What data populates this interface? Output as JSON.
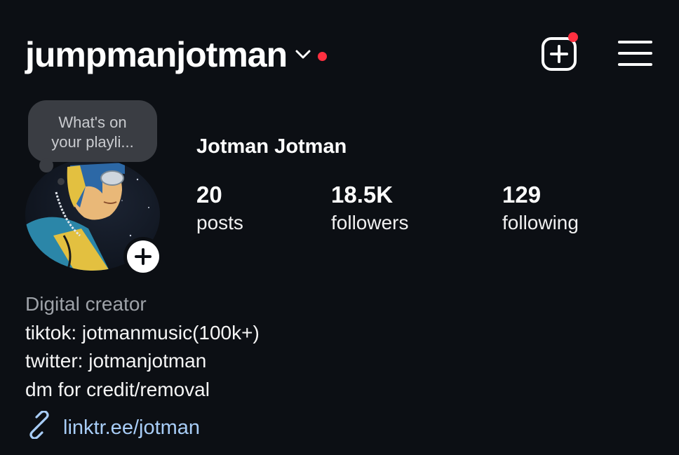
{
  "header": {
    "username": "jumpmanjotman",
    "switch_icon": "chevron-down-icon",
    "notification_dot_color": "#ff3040",
    "create_icon": "plus-square-icon",
    "menu_icon": "hamburger-menu-icon"
  },
  "note": {
    "text_line1": "What's on",
    "text_line2": "your playli..."
  },
  "profile": {
    "full_name": "Jotman Jotman",
    "add_story_icon": "plus-icon",
    "stats": [
      {
        "value": "20",
        "label": "posts"
      },
      {
        "value": "18.5K",
        "label": "followers"
      },
      {
        "value": "129",
        "label": "following"
      }
    ]
  },
  "bio": {
    "category": "Digital creator",
    "lines": [
      "tiktok: jotmanmusic(100k+)",
      "twitter: jotmanjotman",
      "dm for credit/removal"
    ],
    "link_icon": "link-icon",
    "link": "linktr.ee/jotman"
  },
  "colors": {
    "background": "#0c0f14",
    "link": "#a8cdf7",
    "category": "#9ea2a8",
    "note_bubble": "#3a3d43"
  }
}
